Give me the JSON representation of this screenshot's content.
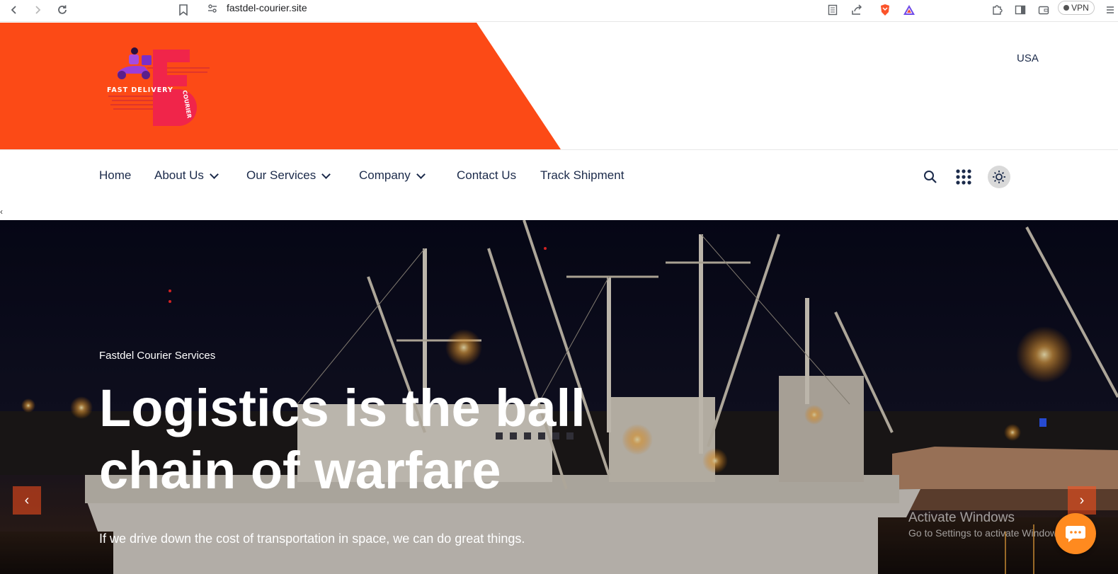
{
  "browser": {
    "url": "fastdel-courier.site",
    "vpn_label": "VPN"
  },
  "header": {
    "brand_color": "#ff4a17",
    "logo_text_top": "FAST DELIVERY",
    "logo_text_side": "COURIER",
    "country": "USA"
  },
  "nav": {
    "items": [
      {
        "label": "Home",
        "dropdown": false
      },
      {
        "label": "About Us",
        "dropdown": true
      },
      {
        "label": "Our Services",
        "dropdown": true
      },
      {
        "label": "Company",
        "dropdown": true
      },
      {
        "label": "Contact Us",
        "dropdown": false
      },
      {
        "label": "Track Shipment",
        "dropdown": false
      }
    ],
    "icons": [
      "search-icon",
      "grid-menu-icon",
      "sun-icon"
    ]
  },
  "hero": {
    "kicker": "Fastdel Courier Services",
    "title": "Logistics is the ball chain of warfare",
    "subtitle": "If we drive down the cost of transportation in space, we can do great things.",
    "prev_arrow": "‹",
    "next_arrow": "›"
  },
  "overlay": {
    "activate_title": "Activate Windows",
    "activate_sub": "Go to Settings to activate Windows."
  }
}
